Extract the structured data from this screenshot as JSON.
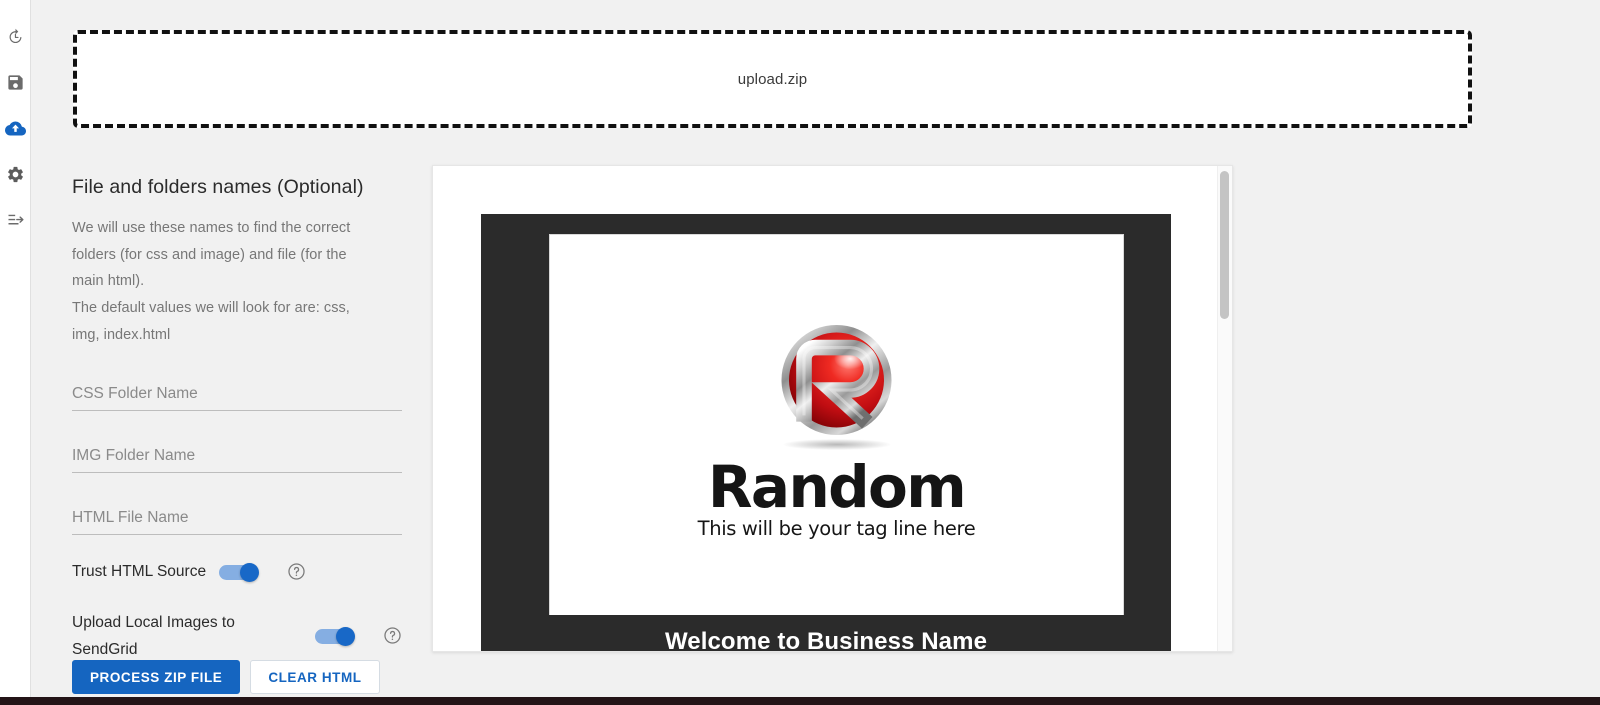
{
  "sidebar": {
    "items": [
      {
        "name": "history-icon",
        "label": "History",
        "active": false
      },
      {
        "name": "save-icon",
        "label": "Save",
        "active": false
      },
      {
        "name": "cloud-upload-icon",
        "label": "Upload",
        "active": true
      },
      {
        "name": "gear-icon",
        "label": "Settings",
        "active": false
      },
      {
        "name": "logout-icon",
        "label": "Log out",
        "active": false
      }
    ]
  },
  "dropzone": {
    "filename": "upload.zip"
  },
  "form": {
    "title": "File and folders names (Optional)",
    "description_line_1": "We will use these names to find the correct",
    "description_line_2": "folders (for css and image) and file (for the",
    "description_line_3": "main html).",
    "description_line_4": "The default values we will look for are: css,",
    "description_line_5": "img, index.html",
    "fields": [
      {
        "placeholder": "CSS Folder Name",
        "value": ""
      },
      {
        "placeholder": "IMG Folder Name",
        "value": ""
      },
      {
        "placeholder": "HTML File Name",
        "value": ""
      }
    ],
    "toggles": [
      {
        "label": "Trust HTML Source",
        "state": "on",
        "help": "?"
      },
      {
        "label": "Upload Local Images to SendGrid",
        "state": "on",
        "help": "?"
      }
    ],
    "buttons": {
      "primary": "PROCESS ZIP FILE",
      "secondary": "CLEAR HTML"
    }
  },
  "preview": {
    "brand_name": "Random",
    "brand_tagline": "This will be your tag line here",
    "heading": "Welcome to Business Name"
  },
  "colors": {
    "accent": "#1565c0",
    "toggle_track": "#85aee2",
    "toggle_knob": "#1868c7",
    "page_background": "#f1f1f1",
    "email_background": "#2b2b2b",
    "logo_red": "#d71920"
  }
}
